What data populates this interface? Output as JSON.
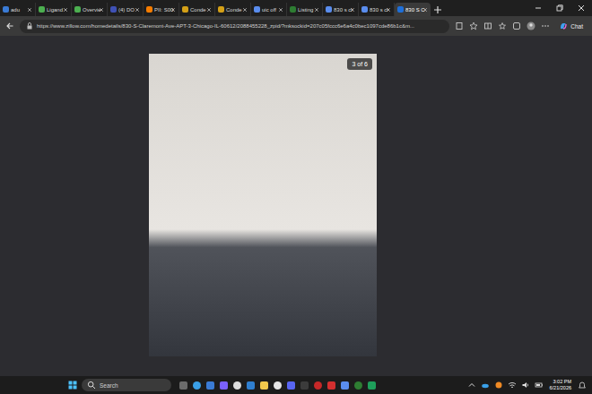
{
  "tabs": [
    {
      "label": "adu",
      "selected": false
    },
    {
      "label": "Ligand",
      "selected": false
    },
    {
      "label": "Overvie",
      "selected": false
    },
    {
      "label": "(4) DO",
      "selected": false
    },
    {
      "label": "PII: S00",
      "selected": false
    },
    {
      "label": "Conde",
      "selected": false
    },
    {
      "label": "Conde",
      "selected": false
    },
    {
      "label": "uic off",
      "selected": false
    },
    {
      "label": "Listing",
      "selected": false
    },
    {
      "label": "830 s cl",
      "selected": false
    },
    {
      "label": "830 s cl",
      "selected": false
    },
    {
      "label": "830 S C",
      "selected": true
    }
  ],
  "address_bar": {
    "url": "https://www.zillow.com/homedetails/830-S-Claremont-Ave-APT-3-Chicago-IL-60612/2088455228_zpid/?mksockid=207c05fccc6e6a4c0bec1097cde86b1c&m..."
  },
  "chat_button": "Chat",
  "photo": {
    "counter": "3 of 6"
  },
  "taskbar": {
    "search_placeholder": "Search",
    "time": "3:02 PM",
    "date": "6/21/2026"
  }
}
